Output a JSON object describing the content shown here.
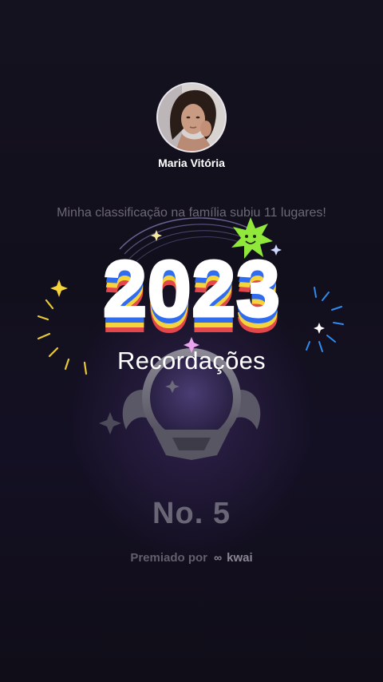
{
  "profile": {
    "name": "Maria Vitória"
  },
  "achievement": {
    "text": "Minha classificação na família subiu 11 lugares!"
  },
  "overlay": {
    "year": "2023",
    "title": "Recordações"
  },
  "rank": {
    "label": "No. 5"
  },
  "awarded": {
    "prefix": "Premiado por",
    "brand": "kwai"
  },
  "colors": {
    "background": "#120f1c",
    "stripe_blue": "#2f6cf0",
    "stripe_red": "#e2474b",
    "stripe_yellow": "#f5d33a",
    "smiley_green": "#8fe83a"
  }
}
